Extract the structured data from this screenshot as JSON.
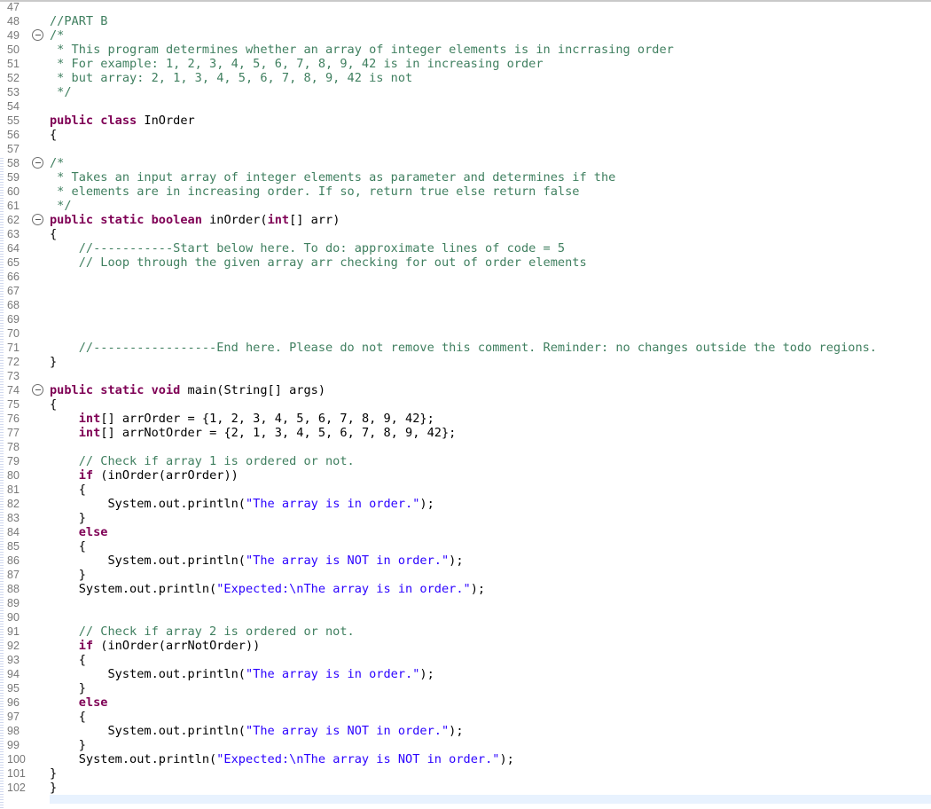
{
  "editor": {
    "lines": [
      {
        "n": "47",
        "segs": []
      },
      {
        "n": "48",
        "segs": [
          {
            "t": "//PART B",
            "c": "c"
          }
        ]
      },
      {
        "n": "49",
        "fold": true,
        "segs": [
          {
            "t": "/*",
            "c": "c"
          }
        ]
      },
      {
        "n": "50",
        "segs": [
          {
            "t": " * This program determines whether an array of integer elements is in incrrasing order",
            "c": "c"
          }
        ]
      },
      {
        "n": "51",
        "segs": [
          {
            "t": " * For example: 1, 2, 3, 4, 5, 6, 7, 8, 9, 42 is in increasing order",
            "c": "c"
          }
        ]
      },
      {
        "n": "52",
        "segs": [
          {
            "t": " * but array: 2, 1, 3, 4, 5, 6, 7, 8, 9, 42 is not",
            "c": "c"
          }
        ]
      },
      {
        "n": "53",
        "segs": [
          {
            "t": " */",
            "c": "c"
          }
        ]
      },
      {
        "n": "54",
        "segs": []
      },
      {
        "n": "55",
        "segs": [
          {
            "t": "public",
            "c": "k"
          },
          {
            "t": " "
          },
          {
            "t": "class",
            "c": "k"
          },
          {
            "t": " InOrder"
          }
        ]
      },
      {
        "n": "56",
        "segs": [
          {
            "t": "{"
          }
        ]
      },
      {
        "n": "57",
        "segs": []
      },
      {
        "n": "58",
        "fold": true,
        "segs": [
          {
            "t": "/*",
            "c": "c"
          }
        ]
      },
      {
        "n": "59",
        "segs": [
          {
            "t": " * Takes an input array of integer elements as parameter and determines if the",
            "c": "c"
          }
        ]
      },
      {
        "n": "60",
        "segs": [
          {
            "t": " * elements are in increasing order. If so, return true else return false",
            "c": "c"
          }
        ]
      },
      {
        "n": "61",
        "segs": [
          {
            "t": " */",
            "c": "c"
          }
        ]
      },
      {
        "n": "62",
        "fold": true,
        "segs": [
          {
            "t": "public",
            "c": "k"
          },
          {
            "t": " "
          },
          {
            "t": "static",
            "c": "k"
          },
          {
            "t": " "
          },
          {
            "t": "boolean",
            "c": "k"
          },
          {
            "t": " inOrder("
          },
          {
            "t": "int",
            "c": "k"
          },
          {
            "t": "[] arr)"
          }
        ]
      },
      {
        "n": "63",
        "segs": [
          {
            "t": "{"
          }
        ]
      },
      {
        "n": "64",
        "segs": [
          {
            "t": "    //-----------Start below here. To do: approximate lines of code = 5",
            "c": "c"
          }
        ]
      },
      {
        "n": "65",
        "segs": [
          {
            "t": "    // Loop through the given array arr checking for out of order elements",
            "c": "c"
          }
        ]
      },
      {
        "n": "66",
        "segs": []
      },
      {
        "n": "67",
        "segs": []
      },
      {
        "n": "68",
        "segs": []
      },
      {
        "n": "69",
        "segs": []
      },
      {
        "n": "70",
        "segs": []
      },
      {
        "n": "71",
        "segs": [
          {
            "t": "    //-----------------End here. Please do not remove this comment. Reminder: no changes outside the todo regions.",
            "c": "c"
          }
        ]
      },
      {
        "n": "72",
        "segs": [
          {
            "t": "}"
          }
        ]
      },
      {
        "n": "73",
        "segs": []
      },
      {
        "n": "74",
        "fold": true,
        "segs": [
          {
            "t": "public",
            "c": "k"
          },
          {
            "t": " "
          },
          {
            "t": "static",
            "c": "k"
          },
          {
            "t": " "
          },
          {
            "t": "void",
            "c": "k"
          },
          {
            "t": " main(String[] args)"
          }
        ]
      },
      {
        "n": "75",
        "segs": [
          {
            "t": "{"
          }
        ]
      },
      {
        "n": "76",
        "segs": [
          {
            "t": "    "
          },
          {
            "t": "int",
            "c": "k"
          },
          {
            "t": "[] arrOrder = {1, 2, 3, 4, 5, 6, 7, 8, 9, 42};"
          }
        ]
      },
      {
        "n": "77",
        "segs": [
          {
            "t": "    "
          },
          {
            "t": "int",
            "c": "k"
          },
          {
            "t": "[] arrNotOrder = {2, 1, 3, 4, 5, 6, 7, 8, 9, 42};"
          }
        ]
      },
      {
        "n": "78",
        "segs": []
      },
      {
        "n": "79",
        "segs": [
          {
            "t": "    // Check if array 1 is ordered or not.",
            "c": "c"
          }
        ]
      },
      {
        "n": "80",
        "segs": [
          {
            "t": "    "
          },
          {
            "t": "if",
            "c": "k"
          },
          {
            "t": " (inOrder(arrOrder))"
          }
        ]
      },
      {
        "n": "81",
        "segs": [
          {
            "t": "    {"
          }
        ]
      },
      {
        "n": "82",
        "segs": [
          {
            "t": "        System.out.println("
          },
          {
            "t": "\"The array is in order.\"",
            "c": "s"
          },
          {
            "t": ");"
          }
        ]
      },
      {
        "n": "83",
        "segs": [
          {
            "t": "    }"
          }
        ]
      },
      {
        "n": "84",
        "segs": [
          {
            "t": "    "
          },
          {
            "t": "else",
            "c": "k"
          }
        ]
      },
      {
        "n": "85",
        "segs": [
          {
            "t": "    {"
          }
        ]
      },
      {
        "n": "86",
        "segs": [
          {
            "t": "        System.out.println("
          },
          {
            "t": "\"The array is NOT in order.\"",
            "c": "s"
          },
          {
            "t": ");"
          }
        ]
      },
      {
        "n": "87",
        "segs": [
          {
            "t": "    }"
          }
        ]
      },
      {
        "n": "88",
        "segs": [
          {
            "t": "    System.out.println("
          },
          {
            "t": "\"Expected:\\nThe array is in order.\"",
            "c": "s"
          },
          {
            "t": ");"
          }
        ]
      },
      {
        "n": "89",
        "segs": []
      },
      {
        "n": "90",
        "segs": []
      },
      {
        "n": "91",
        "segs": [
          {
            "t": "    // Check if array 2 is ordered or not.",
            "c": "c"
          }
        ]
      },
      {
        "n": "92",
        "segs": [
          {
            "t": "    "
          },
          {
            "t": "if",
            "c": "k"
          },
          {
            "t": " (inOrder(arrNotOrder))"
          }
        ]
      },
      {
        "n": "93",
        "segs": [
          {
            "t": "    {"
          }
        ]
      },
      {
        "n": "94",
        "segs": [
          {
            "t": "        System.out.println("
          },
          {
            "t": "\"The array is in order.\"",
            "c": "s"
          },
          {
            "t": ");"
          }
        ]
      },
      {
        "n": "95",
        "segs": [
          {
            "t": "    }"
          }
        ]
      },
      {
        "n": "96",
        "segs": [
          {
            "t": "    "
          },
          {
            "t": "else",
            "c": "k"
          }
        ]
      },
      {
        "n": "97",
        "segs": [
          {
            "t": "    {"
          }
        ]
      },
      {
        "n": "98",
        "segs": [
          {
            "t": "        System.out.println("
          },
          {
            "t": "\"The array is NOT in order.\"",
            "c": "s"
          },
          {
            "t": ");"
          }
        ]
      },
      {
        "n": "99",
        "segs": [
          {
            "t": "    }"
          }
        ]
      },
      {
        "n": "100",
        "segs": [
          {
            "t": "    System.out.println("
          },
          {
            "t": "\"Expected:\\nThe array is NOT in order.\"",
            "c": "s"
          },
          {
            "t": ");"
          }
        ]
      },
      {
        "n": "101",
        "segs": [
          {
            "t": "}"
          }
        ]
      },
      {
        "n": "102",
        "segs": [
          {
            "t": "}"
          }
        ]
      }
    ]
  },
  "colors": {
    "comment": "#3f7f5f",
    "keyword": "#7f0055",
    "string": "#2a00ff",
    "line_number": "#787878"
  }
}
